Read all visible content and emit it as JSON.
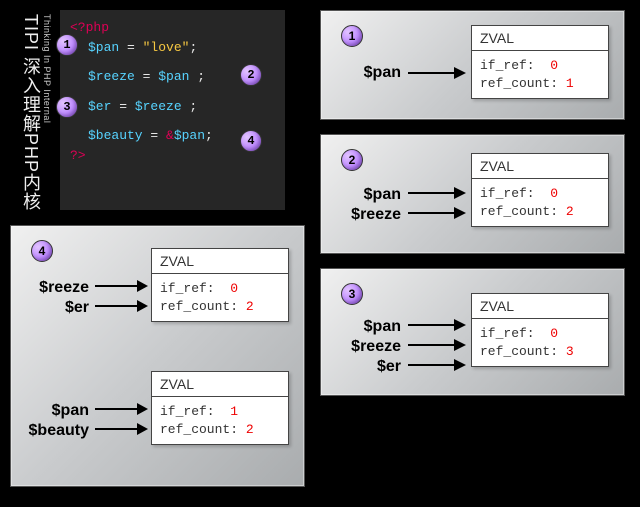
{
  "tipi": {
    "main": "TIPI 深入理解PHP内核",
    "sub": "Thinking In PHP Internal"
  },
  "code": {
    "open": "<?php",
    "close": "?>",
    "lines": [
      {
        "var": "$pan",
        "op": " = ",
        "rhs_str": "\"love\"",
        "semi": ";"
      },
      {
        "var": "$reeze",
        "op": " = ",
        "rhs_var": "$pan",
        "semi": " ;"
      },
      {
        "var": "$er",
        "op": "  = ",
        "rhs_var": "$reeze",
        "semi": " ;"
      },
      {
        "var": "$beauty",
        "op": " = ",
        "amp": "&",
        "rhs_var": "$pan",
        "semi": ";"
      }
    ],
    "badges": [
      "1",
      "2",
      "3",
      "4"
    ]
  },
  "panels": {
    "p1": {
      "badge": "1",
      "vars": [
        "$pan"
      ],
      "zval": {
        "title": "ZVAL",
        "if_ref_label": "if_ref:",
        "if_ref": "0",
        "rc_label": "ref_count:",
        "rc": "1"
      }
    },
    "p2": {
      "badge": "2",
      "vars": [
        "$pan",
        "$reeze"
      ],
      "zval": {
        "title": "ZVAL",
        "if_ref_label": "if_ref:",
        "if_ref": "0",
        "rc_label": "ref_count:",
        "rc": "2"
      }
    },
    "p3": {
      "badge": "3",
      "vars": [
        "$pan",
        "$reeze",
        "$er"
      ],
      "zval": {
        "title": "ZVAL",
        "if_ref_label": "if_ref:",
        "if_ref": "0",
        "rc_label": "ref_count:",
        "rc": "3"
      }
    },
    "p4": {
      "badge": "4",
      "top": {
        "vars": [
          "$reeze",
          "$er"
        ],
        "zval": {
          "title": "ZVAL",
          "if_ref_label": "if_ref:",
          "if_ref": "0",
          "rc_label": "ref_count:",
          "rc": "2"
        }
      },
      "bottom": {
        "vars": [
          "$pan",
          "$beauty"
        ],
        "zval": {
          "title": "ZVAL",
          "if_ref_label": "if_ref:",
          "if_ref": "1",
          "rc_label": "ref_count:",
          "rc": "2"
        }
      }
    }
  }
}
